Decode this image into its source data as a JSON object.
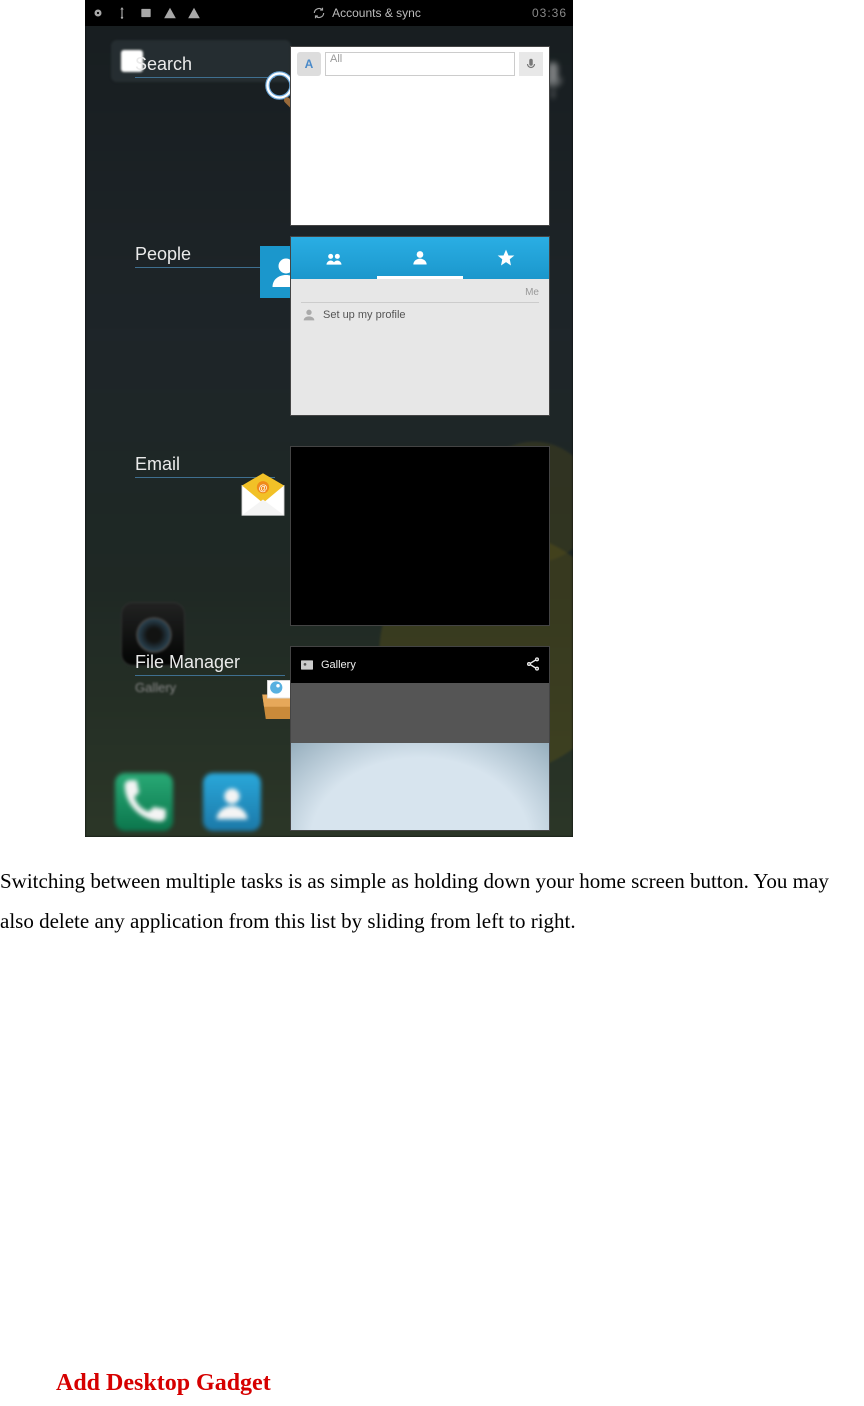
{
  "status_bar": {
    "sync_label": "Accounts & sync",
    "time": "03:36"
  },
  "search_widget": {
    "placeholder": "Search"
  },
  "tasks": {
    "search": {
      "label": "Search",
      "input_hint": "All"
    },
    "people": {
      "label": "People",
      "me_label": "Me",
      "setup_text": "Set up my profile"
    },
    "email": {
      "label": "Email"
    },
    "filemgr": {
      "label": "File Manager",
      "sublabel": "Gallery",
      "gallery_title": "Gallery"
    }
  },
  "body_text": "Switching between multiple tasks is as simple as holding down your home screen button. You may also delete any application from this list by sliding from left to right.",
  "heading": "Add Desktop Gadget"
}
